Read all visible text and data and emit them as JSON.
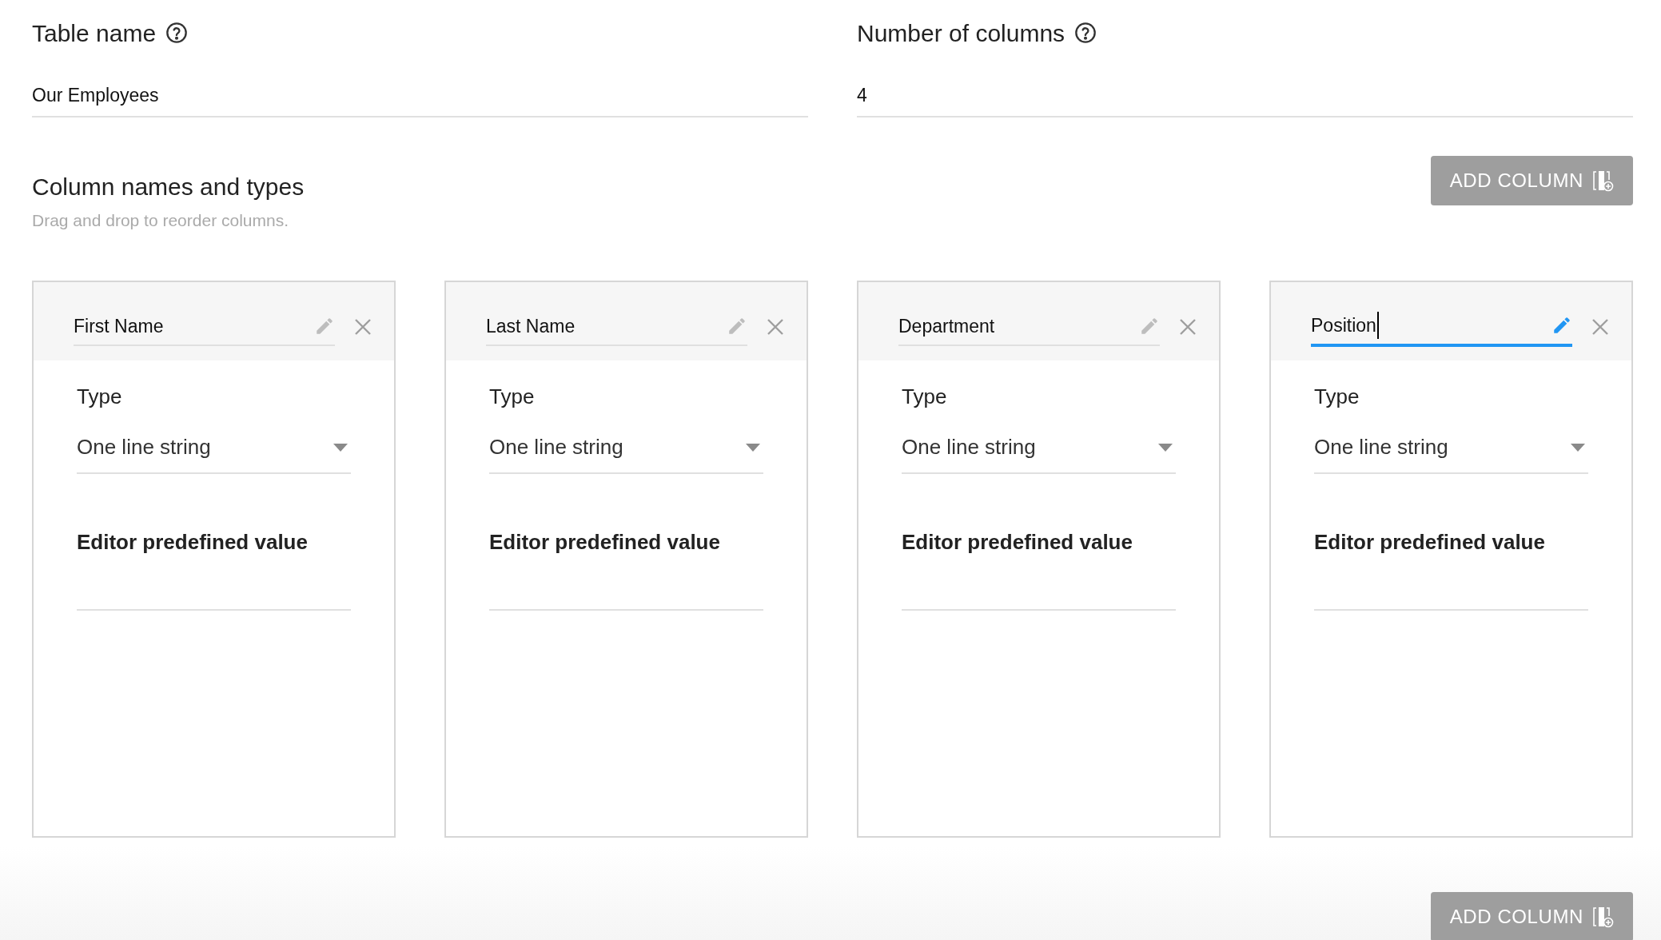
{
  "table_name": {
    "label": "Table name",
    "value": "Our Employees"
  },
  "number_of_columns": {
    "label": "Number of columns",
    "value": "4"
  },
  "section": {
    "title": "Column names and types",
    "subtitle": "Drag and drop to reorder columns."
  },
  "add_column_top": "ADD COLUMN",
  "columns": [
    {
      "name": "First Name",
      "focused": false,
      "type_label": "Type",
      "type_value": "One line string",
      "predefined_label": "Editor predefined value"
    },
    {
      "name": "Last Name",
      "focused": false,
      "type_label": "Type",
      "type_value": "One line string",
      "predefined_label": "Editor predefined value"
    },
    {
      "name": "Department",
      "focused": false,
      "type_label": "Type",
      "type_value": "One line string",
      "predefined_label": "Editor predefined value"
    },
    {
      "name": "Position",
      "focused": true,
      "type_label": "Type",
      "type_value": "One line string",
      "predefined_label": "Editor predefined value"
    }
  ],
  "add_column_bottom": "ADD COLUMN"
}
